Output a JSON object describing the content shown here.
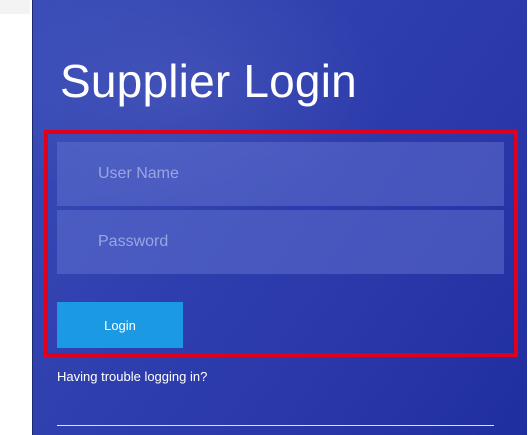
{
  "login": {
    "title": "Supplier Login",
    "username_placeholder": "User Name",
    "username_value": "",
    "password_placeholder": "Password",
    "password_value": "",
    "login_label": "Login",
    "trouble_link": "Having trouble logging in?"
  },
  "colors": {
    "panel_background": "#2f3fae",
    "input_background": "#5f70cd",
    "login_button": "#1b9ae3",
    "highlight_border": "#e0001b",
    "text": "#ffffff"
  }
}
